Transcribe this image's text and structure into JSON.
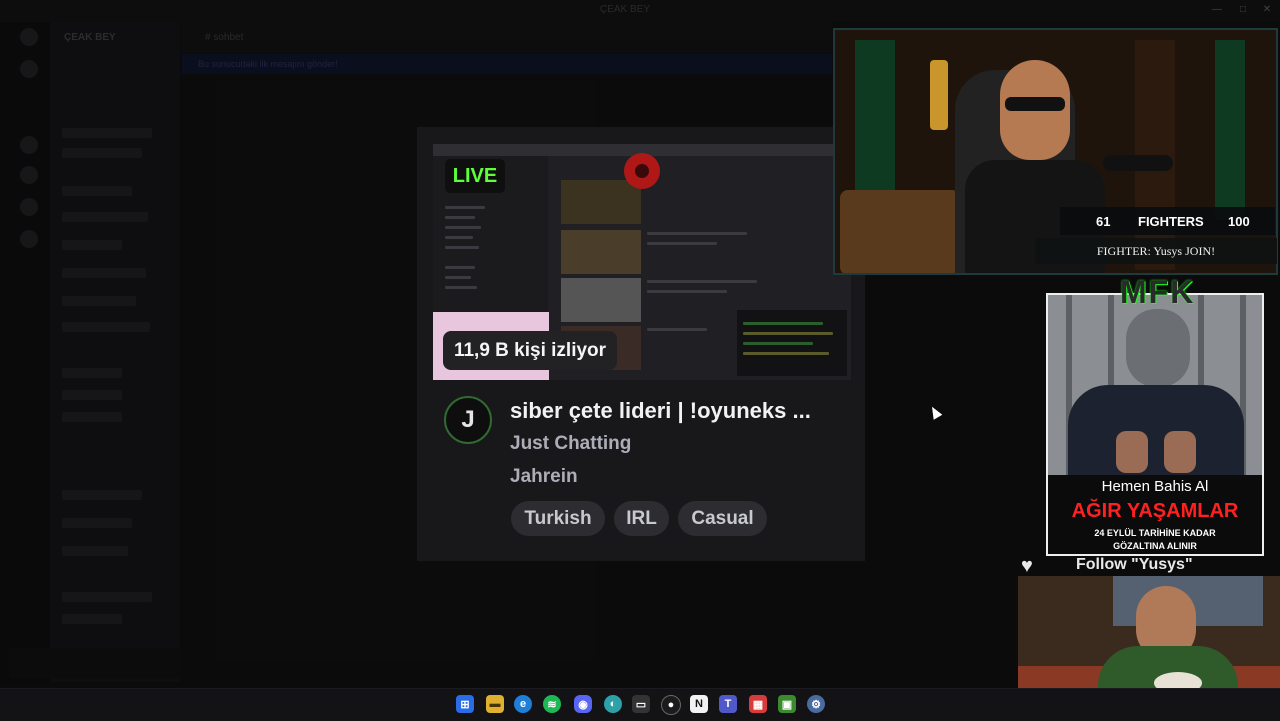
{
  "background_app": {
    "window_title": "ÇEAK BEY",
    "server_name": "ÇEAK BEY",
    "chat_title": "# sohbet",
    "banner_text": "Bu sunucudaki ilk mesajını gönder!"
  },
  "stream_card": {
    "live_label": "LIVE",
    "viewers": "11,9 B kişi izliyor",
    "title": "siber çete lideri | !oyuneks ...",
    "category": "Just Chatting",
    "streamer": "Jahrein",
    "avatar_letter": "J",
    "tags": [
      "Turkish",
      "IRL",
      "Casual"
    ]
  },
  "webcam_overlay": {
    "fighters_left": "61",
    "fighters_label": "FIGHTERS",
    "fighters_right": "100",
    "fighter_message": "FIGHTER: Yusys JOIN!"
  },
  "ad_panel": {
    "logo_text": "MFK",
    "line1": "Hemen Bahis Al",
    "line2": "AĞIR YAŞAMLAR",
    "line3": "24 EYLÜL TARİHİNE KADAR",
    "line4": "GÖZALTINA ALINIR"
  },
  "follow": {
    "label": "Follow \"Yusys\""
  },
  "taskbar": {
    "icons": [
      "windows-start-icon",
      "file-explorer-icon",
      "edge-icon",
      "spotify-icon",
      "discord-icon",
      "browser-icon",
      "app-icon",
      "obs-icon",
      "notion-icon",
      "teams-icon",
      "calendar-icon",
      "minecraft-icon",
      "settings-icon"
    ]
  },
  "colors": {
    "live_green": "#5eff3a",
    "card_bg": "#18181b",
    "ad_red": "#ff2020"
  }
}
